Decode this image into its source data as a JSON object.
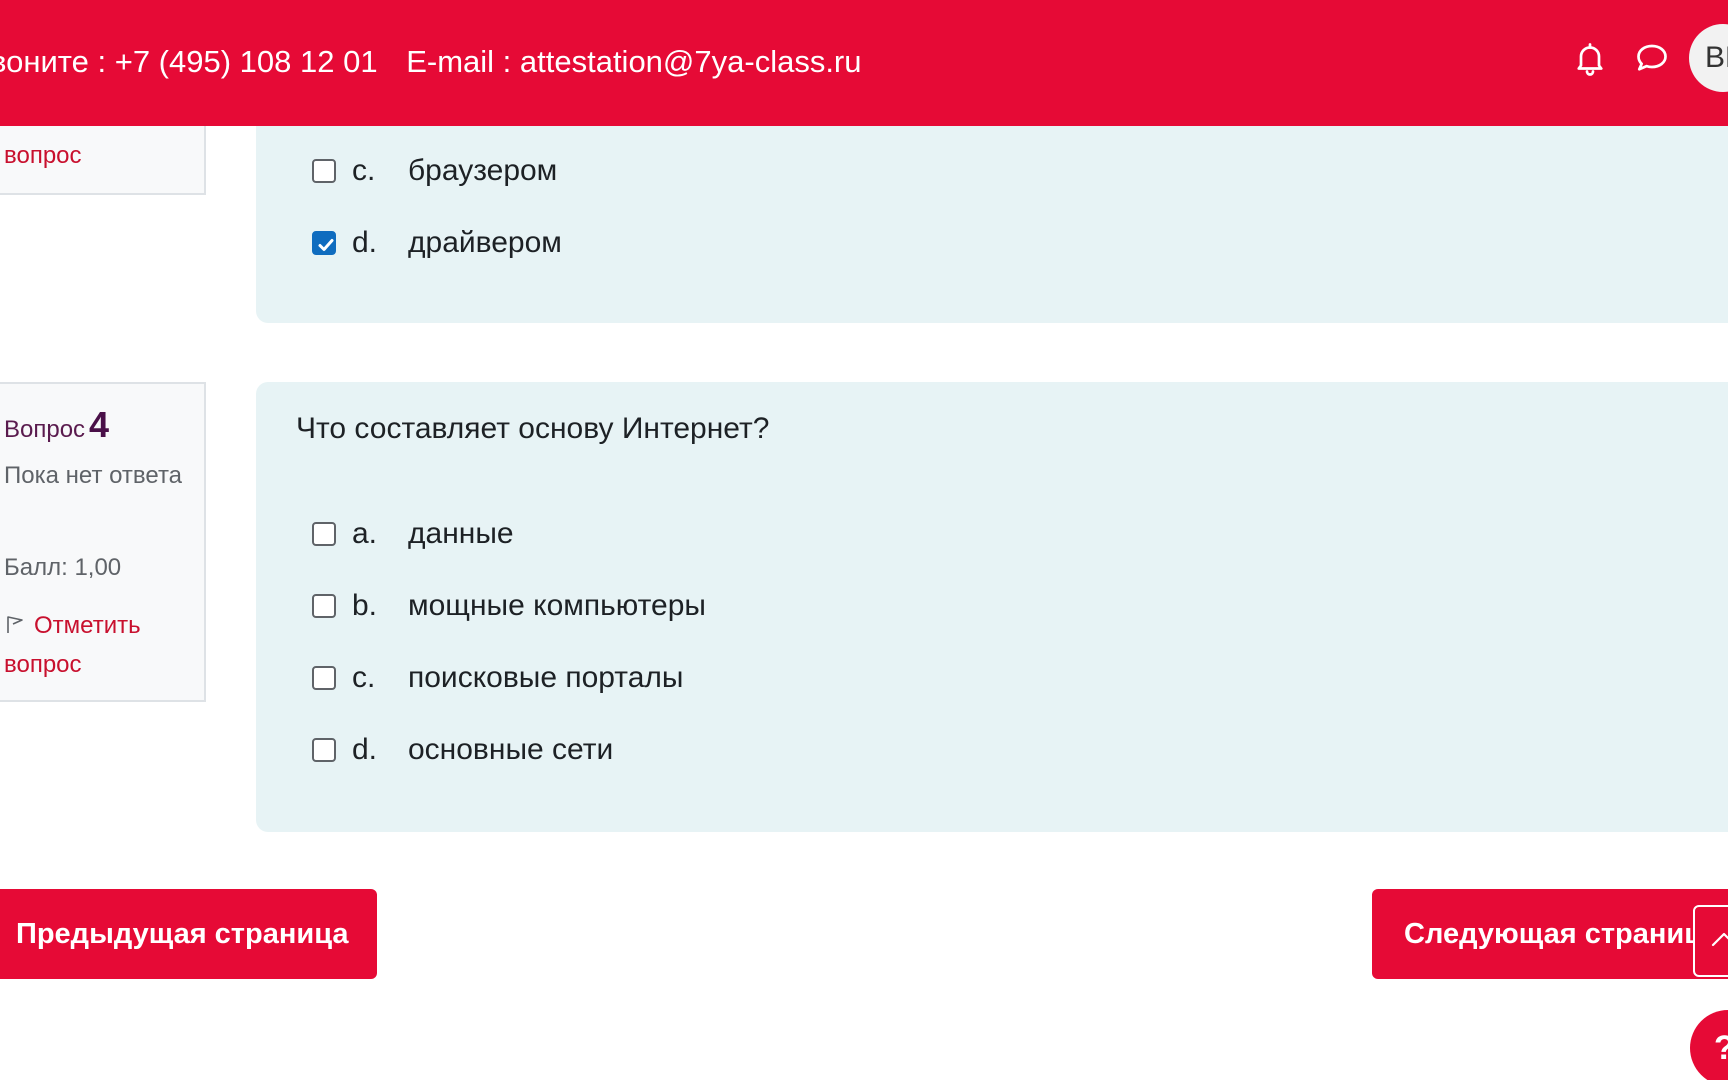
{
  "header": {
    "phone_text": "воните : +7 (495) 108 12 01",
    "email_text": "E-mail : attestation@7ya-class.ru",
    "avatar_initials": "ВЕ",
    "bell_icon": "bell-icon",
    "chat_icon": "chat-icon",
    "accent_color": "#e60a36"
  },
  "question3": {
    "flag_label": "вопрос",
    "options": [
      {
        "letter": "c.",
        "text": "браузером",
        "checked": false
      },
      {
        "letter": "d.",
        "text": "драйвером",
        "checked": true
      }
    ]
  },
  "question4": {
    "label": "Вопрос",
    "number": "4",
    "state": "Пока нет ответа",
    "grade": "Балл: 1,00",
    "flag_label": "Отметить вопрос",
    "text": "Что составляет основу Интернет?",
    "options": [
      {
        "letter": "a.",
        "text": "данные",
        "checked": false
      },
      {
        "letter": "b.",
        "text": "мощные компьютеры",
        "checked": false
      },
      {
        "letter": "c.",
        "text": "поисковые порталы",
        "checked": false
      },
      {
        "letter": "d.",
        "text": "основные сети",
        "checked": false
      }
    ]
  },
  "navigation": {
    "prev_label": "Предыдущая страница",
    "next_label": "Следующая страница"
  },
  "help": {
    "label": "?"
  }
}
